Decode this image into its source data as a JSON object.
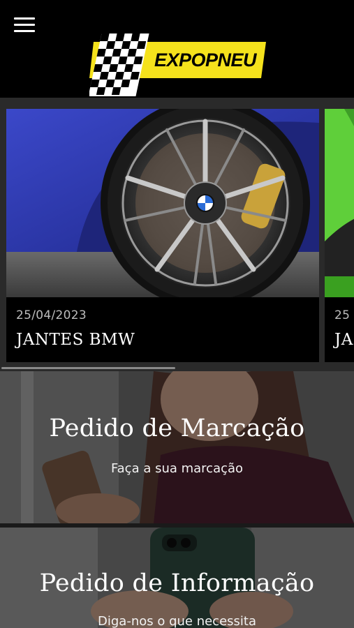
{
  "header": {
    "logo_text": "EXPOPNEU",
    "brand_color": "#f5e21c"
  },
  "carousel": {
    "cards": [
      {
        "date": "25/04/2023",
        "title": "JANTES BMW"
      },
      {
        "date": "25",
        "title": "JA"
      }
    ]
  },
  "banners": [
    {
      "title": "Pedido de Marcação",
      "subtitle": "Faça a sua marcação"
    },
    {
      "title": "Pedido de Informação",
      "subtitle": "Diga-nos o que necessita"
    }
  ]
}
